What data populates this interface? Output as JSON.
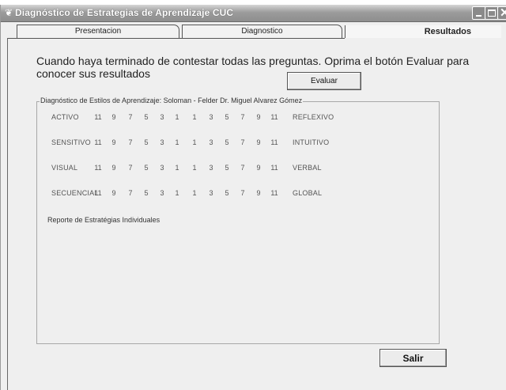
{
  "window": {
    "title": "Diagnóstico de Estrategias de Aprendizaje  CUC",
    "icon": "app-icon"
  },
  "tabs": [
    {
      "label": "Presentacion",
      "active": false
    },
    {
      "label": "Diagnostico",
      "active": false
    },
    {
      "label": "Resultados",
      "active": true
    }
  ],
  "instructions": "Cuando haya terminado de contestar todas las preguntas. Oprima el botón Evaluar para conocer sus resultados",
  "evaluar_label": "Evaluar",
  "group": {
    "title": "Diagnóstico de Estilos de Aprendizaje: Soloman - Felder  Dr. Miguel Alvarez Gómez",
    "scale_left": [
      "11",
      "9",
      "7",
      "5",
      "3",
      "1"
    ],
    "scale_right": [
      "1",
      "3",
      "5",
      "7",
      "9",
      "11"
    ],
    "rows": [
      {
        "left": "ACTIVO",
        "right": "REFLEXIVO"
      },
      {
        "left": "SENSITIVO",
        "right": "INTUITIVO"
      },
      {
        "left": "VISUAL",
        "right": "VERBAL"
      },
      {
        "left": "SECUENCIAL",
        "right": "GLOBAL"
      }
    ],
    "reporte": "Reporte de Estratégias Individuales"
  },
  "salir_label": "Salir"
}
